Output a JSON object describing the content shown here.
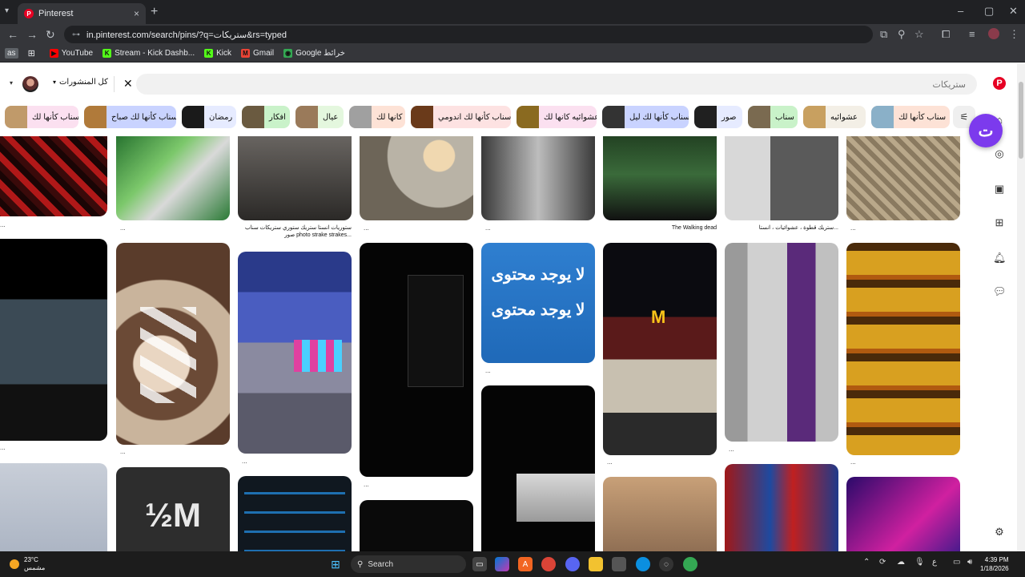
{
  "browser": {
    "tab_title": "Pinterest",
    "tab_close": "×",
    "new_tab": "+",
    "url": "in.pinterest.com/search/pins/?q=ستريكات&rs=typed",
    "bookmarks": [
      {
        "label": "YouTube",
        "color": "#ff0000",
        "glyph": "▶"
      },
      {
        "label": "Stream - Kick Dashb...",
        "color": "#53fc18",
        "glyph": "K"
      },
      {
        "label": "Kick",
        "color": "#53fc18",
        "glyph": "K"
      },
      {
        "label": "Gmail",
        "color": "#ea4335",
        "glyph": "M"
      },
      {
        "label": "Google خرائط",
        "color": "#34a853",
        "glyph": "◉"
      }
    ],
    "bookmark_profile": "as"
  },
  "pinterest": {
    "search_query": "ستريكات",
    "filter_label": "كل المنشورات",
    "chips": [
      {
        "label": "سناب كأنها لك",
        "bg": "#fde2d6"
      },
      {
        "label": "عشوائيه",
        "bg": "#f3efe6"
      },
      {
        "label": "سناب",
        "bg": "#c9f2c9"
      },
      {
        "label": "صور",
        "bg": "#e6ebff"
      },
      {
        "label": "سناب كأنها لك ليل",
        "bg": "#c9d3ff"
      },
      {
        "label": "عشوائيه كانها لك",
        "bg": "#fbe0f0"
      },
      {
        "label": "سناب كأنها لك اندومي",
        "bg": "#fde2e2"
      },
      {
        "label": "كانها لك",
        "bg": "#fde2d6"
      },
      {
        "label": "عيال",
        "bg": "#e4f7de"
      },
      {
        "label": "افكار",
        "bg": "#c9f2c9"
      },
      {
        "label": "رمضان",
        "bg": "#e6ebff"
      },
      {
        "label": "سناب كأنها لك صباح",
        "bg": "#c9d3ff"
      },
      {
        "label": "سناب كأنها لك",
        "bg": "#fbe0f0"
      }
    ],
    "captions": {
      "c2_1": "ستوريات انستا ستريك ستوري ستريكات سناب صور photo strake strakes...",
      "c5_1": "The Walking dead",
      "c6_1": "ستريك قطوة ، عشوائيات ، انستا...",
      "img_no_content": "لا يوجد محتوى",
      "img_half_m": "½M"
    },
    "ellipsis": "...",
    "fab_label": "ت"
  },
  "taskbar": {
    "temperature": "23°C",
    "condition": "مشمس",
    "search_label": "Search",
    "time": "4:39 PM",
    "date": "1/18/2026"
  }
}
